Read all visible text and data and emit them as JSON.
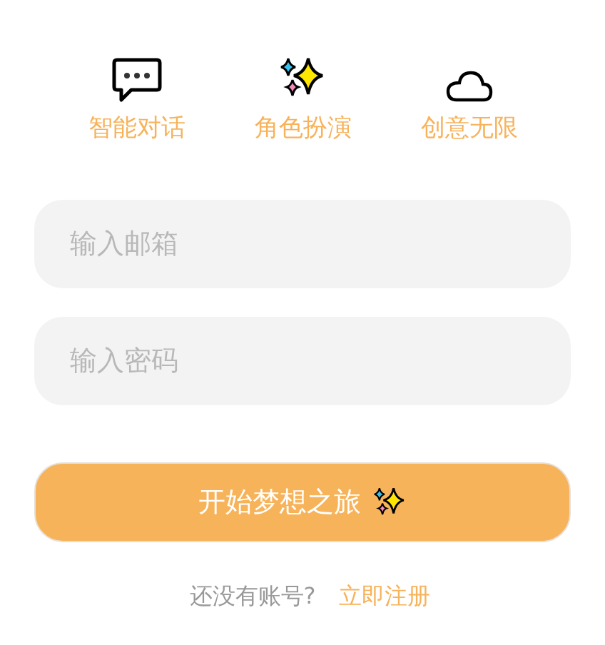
{
  "features": [
    {
      "kind": "chat",
      "label": "智能对话"
    },
    {
      "kind": "sparkles",
      "label": "角色扮演"
    },
    {
      "kind": "cloud",
      "label": "创意无限"
    }
  ],
  "fields": [
    {
      "placeholder": "输入邮箱"
    },
    {
      "placeholder": "输入密码"
    }
  ],
  "submit": {
    "label": "开始梦想之旅"
  },
  "footer": {
    "prompt": "还没有账号?",
    "link": "立即注册"
  }
}
